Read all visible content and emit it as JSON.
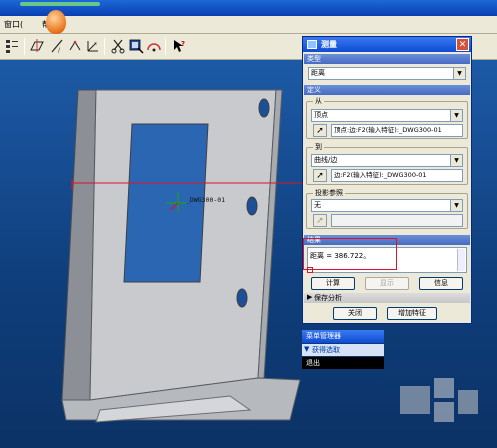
{
  "menubar": {
    "items": [
      "窗口(",
      "帮"
    ]
  },
  "toolbar": {
    "icons": [
      "tree-icon",
      "plane-icon",
      "axis-icon",
      "csys-icon",
      "point-icon",
      "scissors-icon",
      "measure-icon",
      "analysis-icon",
      "whats-this-icon"
    ]
  },
  "model": {
    "dimension_label": "_DWG300-01"
  },
  "dialog": {
    "title": "测量",
    "type_section": "类型",
    "type_value": "距离",
    "define_section": "定义",
    "from_label": "从",
    "from_type": "顶点",
    "from_pick": "顶点:边:F2(输入特征):_DWG300-01",
    "to_label": "到",
    "to_type": "曲线/边",
    "to_pick": "边:F2(输入特征):_DWG300-01",
    "projection_label": "投影参照",
    "projection_value": "无",
    "projection_pick": "",
    "result_section": "结果",
    "result_text": "距离 = 386.722。",
    "buttons": {
      "compute": "计算",
      "display": "显示",
      "info": "信息",
      "close": "关闭",
      "add_feature": "增加特征"
    },
    "save_analysis": "保存分析"
  },
  "menu_manager": {
    "title": "菜单管理器",
    "item_get_select": "获得选取",
    "item_exit": "退出"
  },
  "colors": {
    "annotation_red": "#d8152a",
    "viewport_blue": "#1d5aa6"
  }
}
